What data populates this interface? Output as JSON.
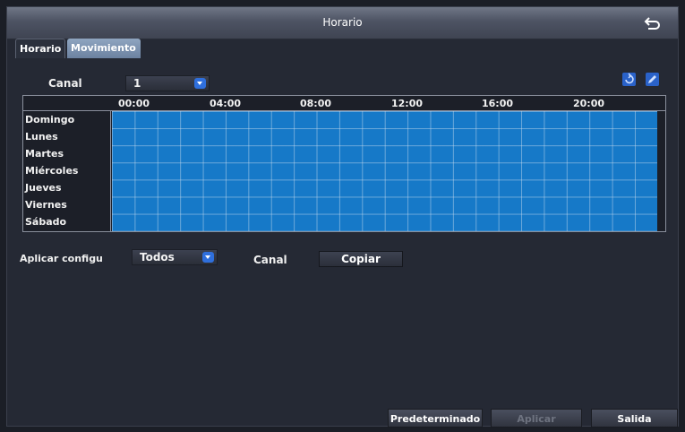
{
  "window": {
    "title": "Horario"
  },
  "tabs": [
    {
      "label": "Horario"
    },
    {
      "label": "Movimiento"
    }
  ],
  "channel": {
    "label": "Canal",
    "value": "1"
  },
  "grid": {
    "times": [
      "00:00",
      "04:00",
      "08:00",
      "12:00",
      "16:00",
      "20:00"
    ],
    "days": [
      "Domingo",
      "Lunes",
      "Martes",
      "Miércoles",
      "Jueves",
      "Viernes",
      "Sábado"
    ],
    "fill_color": "#1679c8"
  },
  "apply": {
    "label": "Aplicar configu",
    "value": "Todos",
    "channel_label": "Canal",
    "copy_label": "Copiar"
  },
  "footer": {
    "default_label": "Predeterminado",
    "apply_label": "Aplicar",
    "exit_label": "Salida"
  },
  "icons": {
    "back": "back-arrow-icon",
    "refresh": "refresh-icon",
    "edit": "pencil-icon"
  }
}
